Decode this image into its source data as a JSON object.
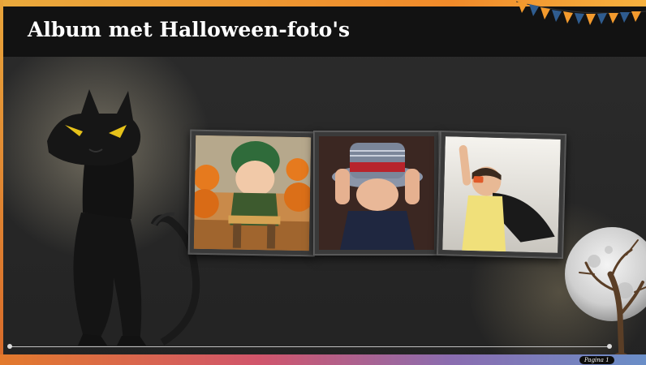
{
  "slide": {
    "title": "Album met Halloween-foto's",
    "page_label": "Pagina 1"
  },
  "photos": [
    {
      "subject": "baby in green knit hat with pumpkins"
    },
    {
      "subject": "toddler pulling striped hat over eyes"
    },
    {
      "subject": "child in superhero cape and goggles"
    }
  ],
  "decorations": {
    "cat": "black-cat-icon",
    "moon": "full-moon-icon",
    "tree": "bare-tree-icon",
    "bunting": "bunting-flags-icon"
  },
  "colors": {
    "title_bar": "#121212",
    "accent_orange": "#f08a2a",
    "bunting_orange": "#f39a2d",
    "bunting_blue": "#2f5c8f"
  }
}
